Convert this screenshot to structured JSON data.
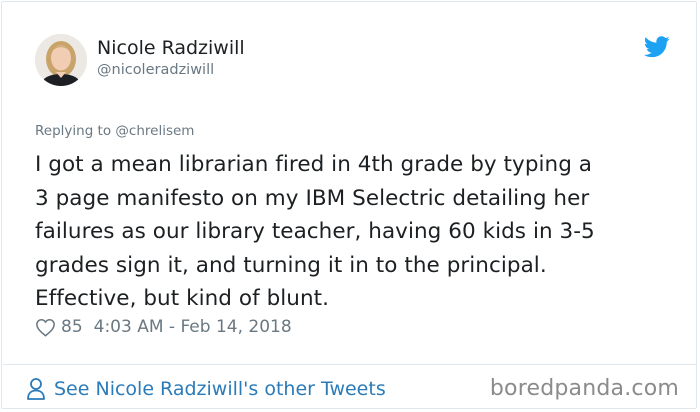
{
  "user": {
    "display_name": "Nicole Radziwill",
    "handle": "@nicoleradziwill"
  },
  "tweet": {
    "replying_prefix": "Replying to",
    "replying_to": "@chrelisem",
    "lines": [
      "I got a mean librarian fired in 4th grade by typing a",
      "3 page manifesto on my IBM Selectric detailing her",
      "failures as our library teacher, having 60 kids in 3-5",
      "grades sign it, and turning it in to the principal.",
      "Effective, but kind of blunt."
    ],
    "likes": "85",
    "timestamp": "4:03 AM - Feb 14, 2018"
  },
  "footer": {
    "see_more_label": "See Nicole Radziwill's other Tweets"
  },
  "watermark": "boredpanda.com",
  "icons": {
    "brand": "twitter-bird-icon",
    "like": "heart-icon",
    "profile": "person-icon"
  },
  "colors": {
    "twitter_blue": "#1da1f2",
    "link_blue": "#2b7bb9",
    "muted_gray": "#697882",
    "text": "#1c2022",
    "border": "#e1e8ed"
  }
}
